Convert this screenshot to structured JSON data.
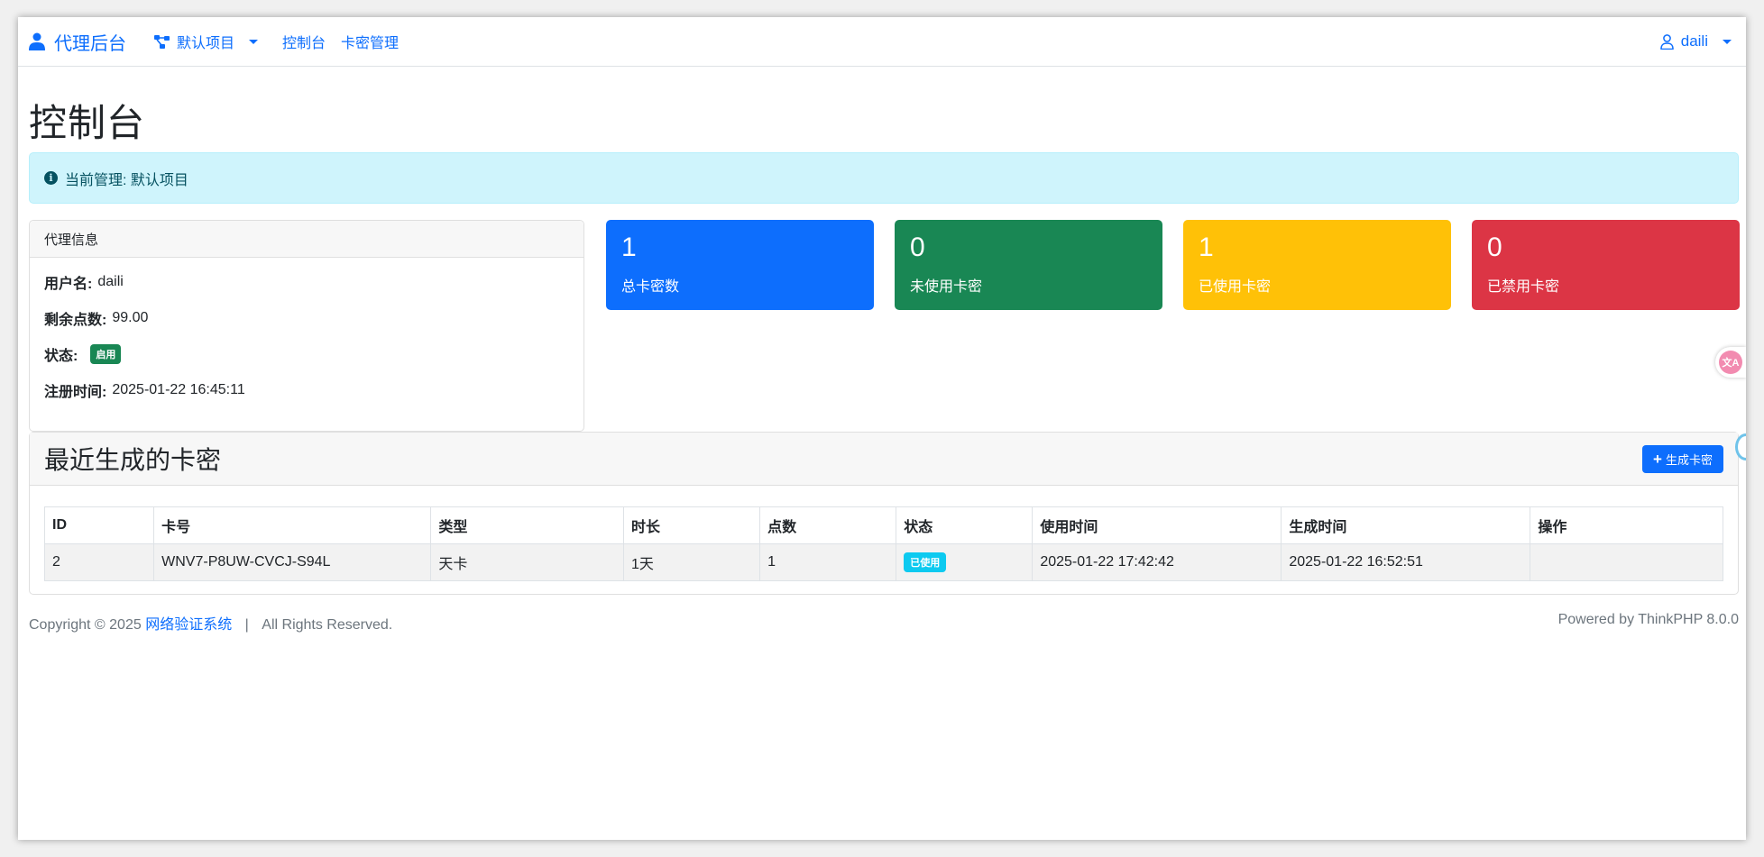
{
  "navbar": {
    "brand": "代理后台",
    "project_label": "默认项目",
    "links": [
      "控制台",
      "卡密管理"
    ],
    "user": "daili"
  },
  "page_title": "控制台",
  "alert": {
    "text": "当前管理: 默认项目"
  },
  "agent_info": {
    "title": "代理信息",
    "username_label": "用户名:",
    "username": "daili",
    "points_label": "剩余点数:",
    "points": "99.00",
    "status_label": "状态:",
    "status": "启用",
    "registered_label": "注册时间:",
    "registered": "2025-01-22 16:45:11"
  },
  "stats": [
    {
      "value": "1",
      "label": "总卡密数",
      "color": "#0d6efd"
    },
    {
      "value": "0",
      "label": "未使用卡密",
      "color": "#198754"
    },
    {
      "value": "1",
      "label": "已使用卡密",
      "color": "#ffc107"
    },
    {
      "value": "0",
      "label": "已禁用卡密",
      "color": "#dc3545"
    }
  ],
  "recent": {
    "title": "最近生成的卡密",
    "generate_button": "生成卡密",
    "columns": [
      "ID",
      "卡号",
      "类型",
      "时长",
      "点数",
      "状态",
      "使用时间",
      "生成时间",
      "操作"
    ],
    "rows": [
      {
        "id": "2",
        "card": "WNV7-P8UW-CVCJ-S94L",
        "type": "天卡",
        "duration": "1天",
        "points": "1",
        "status": "已使用",
        "used_at": "2025-01-22 17:42:42",
        "created_at": "2025-01-22 16:52:51",
        "actions": ""
      }
    ]
  },
  "footer": {
    "copyright": "Copyright © 2025",
    "site_link": "网络验证系统",
    "separator": "|",
    "rights": "All Rights Reserved.",
    "powered": "Powered by ThinkPHP 8.0.0"
  },
  "floating": {
    "translate_icon": "文A"
  }
}
